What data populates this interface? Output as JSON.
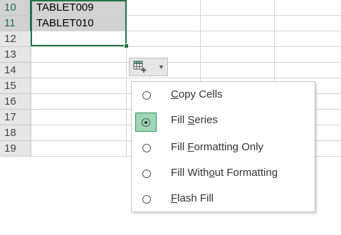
{
  "rows": [
    {
      "num": "10",
      "a": "TABLET009",
      "selected": true
    },
    {
      "num": "11",
      "a": "TABLET010",
      "selected": true
    },
    {
      "num": "12",
      "a": "",
      "selected": false
    },
    {
      "num": "13",
      "a": "",
      "selected": false
    },
    {
      "num": "14",
      "a": "",
      "selected": false
    },
    {
      "num": "15",
      "a": "",
      "selected": false
    },
    {
      "num": "16",
      "a": "",
      "selected": false
    },
    {
      "num": "17",
      "a": "",
      "selected": false
    },
    {
      "num": "18",
      "a": "",
      "selected": false
    },
    {
      "num": "19",
      "a": "",
      "selected": false
    }
  ],
  "autofill_button": {
    "icon": "autofill-options-icon",
    "dropdown_icon": "chevron-down-icon"
  },
  "menu": {
    "items": [
      {
        "pre": "",
        "key": "C",
        "post": "opy Cells",
        "checked": false
      },
      {
        "pre": "Fill ",
        "key": "S",
        "post": "eries",
        "checked": true
      },
      {
        "pre": "Fill ",
        "key": "F",
        "post": "ormatting Only",
        "checked": false
      },
      {
        "pre": "Fill With",
        "key": "o",
        "post": "ut Formatting",
        "checked": false
      },
      {
        "pre": "",
        "key": "F",
        "post": "lash Fill",
        "checked": false
      }
    ]
  },
  "colors": {
    "accent": "#217346",
    "highlight": "#9ed6b6"
  }
}
